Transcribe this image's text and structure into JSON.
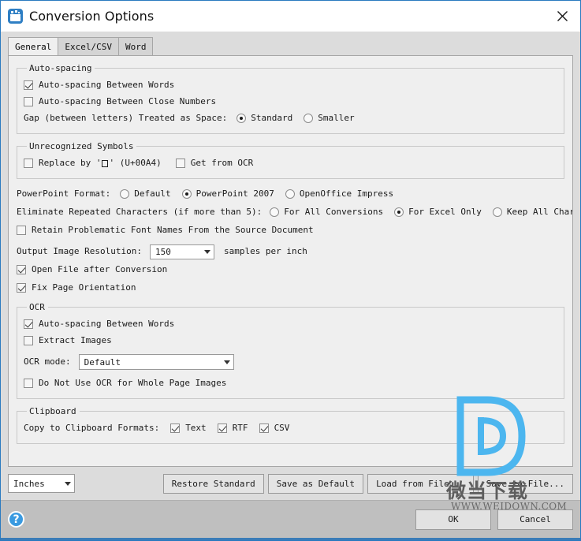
{
  "window": {
    "title": "Conversion Options",
    "app_icon": "conversion-app-icon",
    "close_icon": "close-icon",
    "accent_color": "#2a7ac0"
  },
  "tabs": [
    {
      "label": "General",
      "active": true
    },
    {
      "label": "Excel/CSV",
      "active": false
    },
    {
      "label": "Word",
      "active": false
    }
  ],
  "groups": {
    "autospacing": {
      "legend": "Auto-spacing",
      "between_words": {
        "label": "Auto-spacing Between Words",
        "checked": true
      },
      "close_numbers": {
        "label": "Auto-spacing Between Close Numbers",
        "checked": false
      },
      "gap_label": "Gap (between letters) Treated as Space:",
      "gap_options": [
        {
          "label": "Standard",
          "selected": true
        },
        {
          "label": "Smaller",
          "selected": false
        }
      ]
    },
    "unrecognized": {
      "legend": "Unrecognized Symbols",
      "replace_prefix": "Replace by '",
      "replace_suffix": "' (U+00A4)",
      "replace_checked": false,
      "get_from_ocr": {
        "label": "Get from OCR",
        "checked": false
      }
    },
    "ocr": {
      "legend": "OCR",
      "between_words": {
        "label": "Auto-spacing Between Words",
        "checked": true
      },
      "extract_images": {
        "label": "Extract Images",
        "checked": false
      },
      "mode_label": "OCR mode:",
      "mode_value": "Default",
      "no_ocr_whole_page": {
        "label": "Do Not Use OCR for Whole Page Images",
        "checked": false
      }
    },
    "clipboard": {
      "legend": "Clipboard",
      "formats_label": "Copy to Clipboard Formats:",
      "formats": [
        {
          "label": "Text",
          "checked": true
        },
        {
          "label": "RTF",
          "checked": true
        },
        {
          "label": "CSV",
          "checked": true
        }
      ]
    }
  },
  "powerpoint": {
    "label": "PowerPoint Format:",
    "options": [
      {
        "label": "Default",
        "selected": false
      },
      {
        "label": "PowerPoint 2007",
        "selected": true
      },
      {
        "label": "OpenOffice Impress",
        "selected": false
      }
    ]
  },
  "eliminate": {
    "label": "Eliminate Repeated Characters (if more than 5):",
    "options": [
      {
        "label": "For All Conversions",
        "selected": false
      },
      {
        "label": "For Excel Only",
        "selected": true
      },
      {
        "label": "Keep All Characters",
        "selected": false
      }
    ]
  },
  "retain_fonts": {
    "label": "Retain Problematic Font Names From the Source Document",
    "checked": false
  },
  "resolution": {
    "label": "Output Image Resolution:",
    "value": "150",
    "unit": "samples per inch"
  },
  "open_after": {
    "label": "Open File after Conversion",
    "checked": true
  },
  "fix_orientation": {
    "label": "Fix Page Orientation",
    "checked": true
  },
  "actionbar": {
    "units_value": "Inches",
    "restore_standard": "Restore Standard",
    "save_as_default": "Save as Default",
    "load_from_file": "Load from File...",
    "save_to_file": "Save to File..."
  },
  "footer": {
    "help_icon": "?",
    "ok": "OK",
    "cancel": "Cancel"
  },
  "watermark": {
    "cn_text": "微当下载",
    "url_text": "WWW.WEIDOWN.COM",
    "logo_color": "#4cb6ef"
  }
}
